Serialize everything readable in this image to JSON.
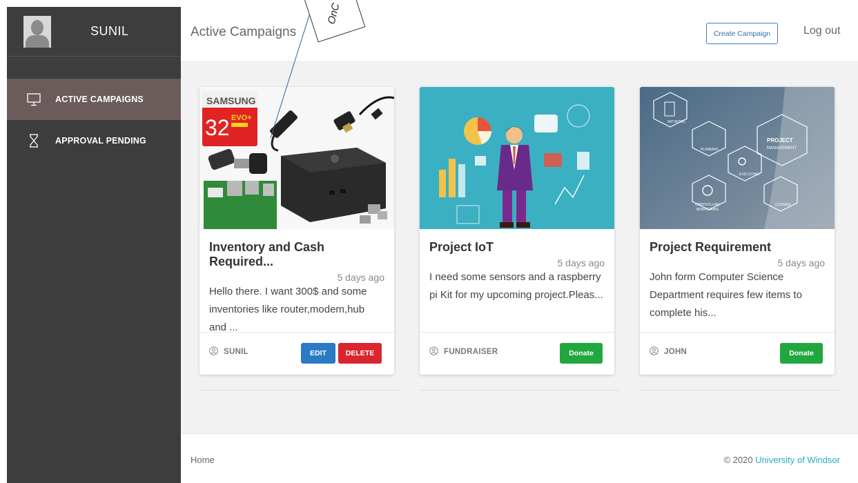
{
  "sidebar": {
    "username": "SUNIL",
    "items": [
      {
        "label": "ACTIVE CAMPAIGNS",
        "icon": "monitor-icon",
        "active": true
      },
      {
        "label": "APPROVAL PENDING",
        "icon": "hourglass-icon",
        "active": false
      }
    ]
  },
  "header": {
    "title": "Active Campaigns",
    "create_label": "Create Campaign",
    "logout_label": "Log out"
  },
  "annotation": {
    "text": "OnC"
  },
  "campaigns": [
    {
      "title": "Inventory and Cash Required...",
      "date": "5 days ago",
      "description": "Hello there. I want 300$ and some inventories like router,modem,hub and ...",
      "author": "SUNIL",
      "edit_label": "EDIT",
      "delete_label": "DELETE",
      "image_text": {
        "brand": "SAMSUNG",
        "capacity": "32",
        "series": "EVO+"
      }
    },
    {
      "title": "Project IoT",
      "date": "5 days ago",
      "description": "I need some sensors and a raspberry pi Kit for my upcoming project.Pleas...",
      "author": "FUNDRAISER",
      "donate_label": "Donate"
    },
    {
      "title": "Project Requirement",
      "date": "5 days ago",
      "description": "John form Computer Science Department requires few items to complete his...",
      "author": "JOHN",
      "donate_label": "Donate",
      "image_text": {
        "center1": "PROJECT",
        "center2": "MANAGEMENT",
        "h1": "INITIATING",
        "h2": "PLANNING",
        "h3": "EXECUTING",
        "h4": "CONTROLLING",
        "h4b": "MONITORING",
        "h5": "CLOSING"
      }
    }
  ],
  "footer": {
    "home_label": "Home",
    "copyright": "© 2020 ",
    "org_link": "University of Windsor"
  },
  "colors": {
    "sidebar_bg": "#3d3d3d",
    "active_item": "#6b5b5b",
    "edit": "#2a7ac6",
    "delete": "#d9262e",
    "donate": "#21a73f",
    "link": "#2aa7c9"
  }
}
